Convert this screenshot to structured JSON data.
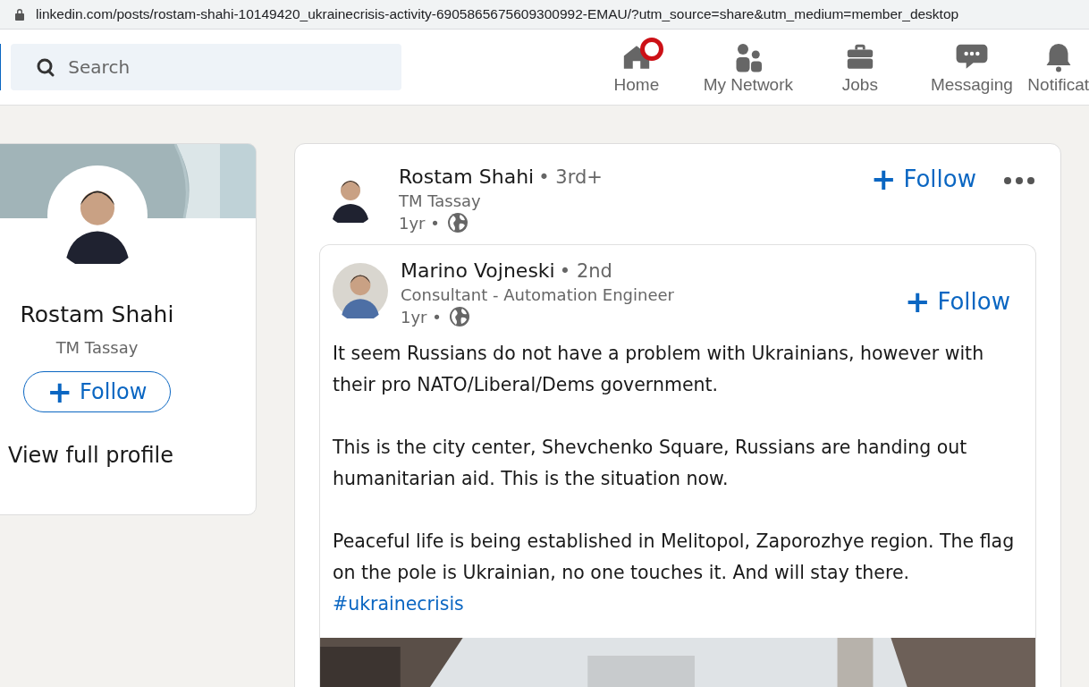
{
  "address_bar": {
    "url": "linkedin.com/posts/rostam-shahi-10149420_ukrainecrisis-activity-6905865675609300992-EMAU/?utm_source=share&utm_medium=member_desktop"
  },
  "top_nav": {
    "search": {
      "placeholder": "Search"
    },
    "items": [
      {
        "label": "Home",
        "kind": "home",
        "notification_dot": true
      },
      {
        "label": "My Network",
        "kind": "network",
        "notification_dot": false
      },
      {
        "label": "Jobs",
        "kind": "jobs",
        "notification_dot": false
      },
      {
        "label": "Messaging",
        "kind": "messaging",
        "notification_dot": false
      },
      {
        "label": "Notificat",
        "kind": "bell",
        "notification_dot": false
      }
    ]
  },
  "profile_card": {
    "name": "Rostam Shahi",
    "headline": "TM Tassay",
    "follow_icon": "+",
    "follow_label": "Follow",
    "link": "View full profile"
  },
  "post": {
    "author": "Rostam Shahi",
    "degree": "• 3rd+",
    "headline": "TM Tassay",
    "time": "1yr •",
    "follow_icon": "+",
    "follow_label": "Follow",
    "shared": {
      "author": "Marino Vojneski",
      "degree": "• 2nd",
      "headline": "Consultant - Automation Engineer",
      "time": "1yr •",
      "follow_icon": "+",
      "follow_label": "Follow",
      "paragraphs": [
        "It seem Russians do not have a problem with Ukrainians, however with their pro NATO/Liberal/Dems government.",
        "This is the city center, Shevchenko Square, Russians are handing out humanitarian aid. This is the situation now.",
        "Peaceful life is being established in Melitopol, Zaporozhye region. The flag on the pole is Ukrainian, no one touches it. And will stay there."
      ],
      "hashtag": "#ukrainecrisis"
    }
  }
}
